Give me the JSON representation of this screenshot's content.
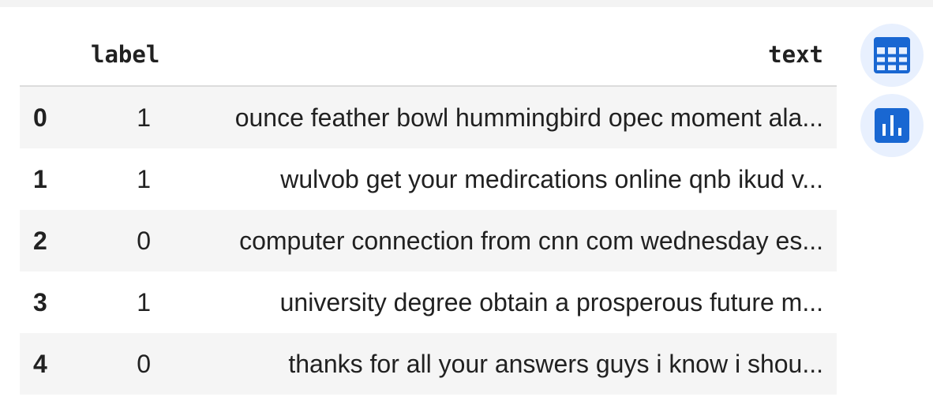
{
  "table": {
    "columns": [
      "",
      "label",
      "text"
    ],
    "rows": [
      {
        "index": "0",
        "label": "1",
        "text": "ounce feather bowl hummingbird opec moment ala..."
      },
      {
        "index": "1",
        "label": "1",
        "text": "wulvob get your medircations online qnb ikud v..."
      },
      {
        "index": "2",
        "label": "0",
        "text": "computer connection from cnn com wednesday es..."
      },
      {
        "index": "3",
        "label": "1",
        "text": "university degree obtain a prosperous future m..."
      },
      {
        "index": "4",
        "label": "0",
        "text": "thanks for all your answers guys i know i shou..."
      }
    ]
  },
  "actions": {
    "table_icon": "table-icon",
    "chart_icon": "bar-chart-icon"
  },
  "colors": {
    "accent": "#1967d2",
    "button_bg": "#e8f0fe",
    "striped_row": "#f5f5f5"
  }
}
